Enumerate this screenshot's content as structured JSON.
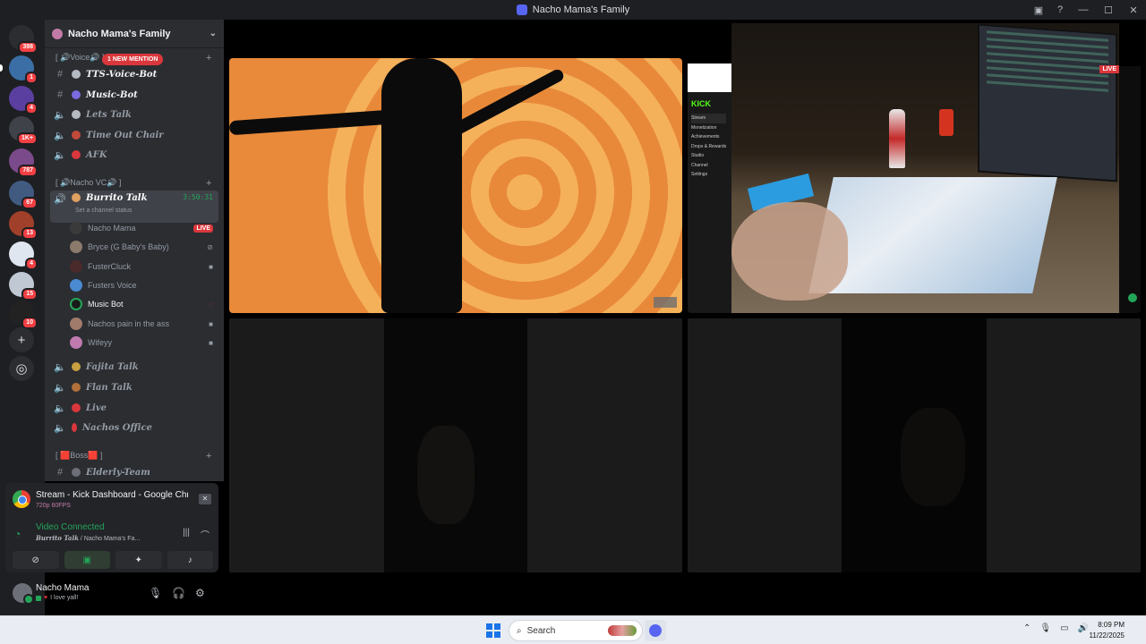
{
  "window": {
    "title": "Nacho Mama's Family"
  },
  "servers": {
    "items": [
      {
        "badge": "398",
        "color": "#2b2d31"
      },
      {
        "badge": "1",
        "color": "#3a6ea5"
      },
      {
        "badge": "4",
        "color": "#5a3fa0"
      },
      {
        "badge": "1K+",
        "color": "#404249"
      },
      {
        "badge": "787",
        "color": "#7a4a8a"
      },
      {
        "badge": "67",
        "color": "#405a80"
      },
      {
        "badge": "13",
        "color": "#a0402a"
      },
      {
        "badge": "4",
        "color": "#dfe6ef"
      },
      {
        "badge": "15",
        "color": "#c0c8d4"
      },
      {
        "badge": "10",
        "color": "#222"
      }
    ]
  },
  "guild": {
    "name": "Nacho Mama's Family"
  },
  "categories": {
    "voice": "[ 🔊Voice🔊 ]",
    "nacho_vc": "[ 🔊Nacho VC🔊 ]",
    "boss": "[ 🟥Boss🟥 ]"
  },
  "mention_badge": "1 NEW MENTION",
  "channels": {
    "tts": "TTS-Voice-Bot",
    "music_bot": "Music-Bot",
    "lets_talk": "Lets Talk",
    "time_out": "Time Out Chair",
    "afk": "AFK",
    "burrito": "Burrito Talk",
    "burrito_timer": "3:50:31",
    "burrito_status": "Set a channel status",
    "fajita": "Fajita Talk",
    "flan": "Flan Talk",
    "live": "Live",
    "nachos_office": "Nachos Office",
    "elderly": "Elderly-Team"
  },
  "voice_users": [
    {
      "name": "Nacho Mama",
      "tag": "LIVE"
    },
    {
      "name": "Bryce (G Baby's Baby)"
    },
    {
      "name": "FusterCluck"
    },
    {
      "name": "Fusters Voice"
    },
    {
      "name": "Music Bot"
    },
    {
      "name": "Nachos pain in the ass"
    },
    {
      "name": "Wifeyy"
    }
  ],
  "stream_panel": {
    "title": "Stream - Kick Dashboard - Google Chrome",
    "quality": "720p 60FPS",
    "status": "Video Connected",
    "channel": "Burrito Talk",
    "guild_suffix": " / Nacho Mama's Fa..."
  },
  "user": {
    "name": "Nacho Mama",
    "status": "I love yall!"
  },
  "stage": {
    "live_tag": "LIVE",
    "kick_logo": "KICK",
    "kick_menu": [
      "Stream",
      "Monetization",
      "Achievements",
      "Drops & Rewards",
      "Studio",
      "Channel",
      "Settings"
    ]
  },
  "taskbar": {
    "search_placeholder": "Search",
    "time": "8:09 PM",
    "date": "11/22/2025"
  },
  "colors": {
    "accent": "#5865f2",
    "online": "#23a559",
    "danger": "#da373c"
  }
}
